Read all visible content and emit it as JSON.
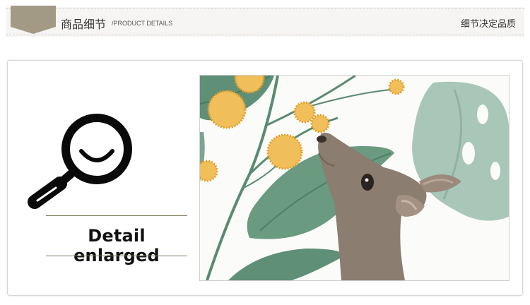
{
  "header": {
    "title": "商品细节",
    "subtitle": "/PRODUCT DETAILS",
    "slogan": "细节决定品质"
  },
  "detail": {
    "caption": "Detail enlarged",
    "icon": "magnifier-icon"
  },
  "colors": {
    "header_tab": "#a39a86",
    "leaf_green": "#6a9a80",
    "flower_yellow": "#e8b24a",
    "deer_brown": "#8b7d70"
  }
}
